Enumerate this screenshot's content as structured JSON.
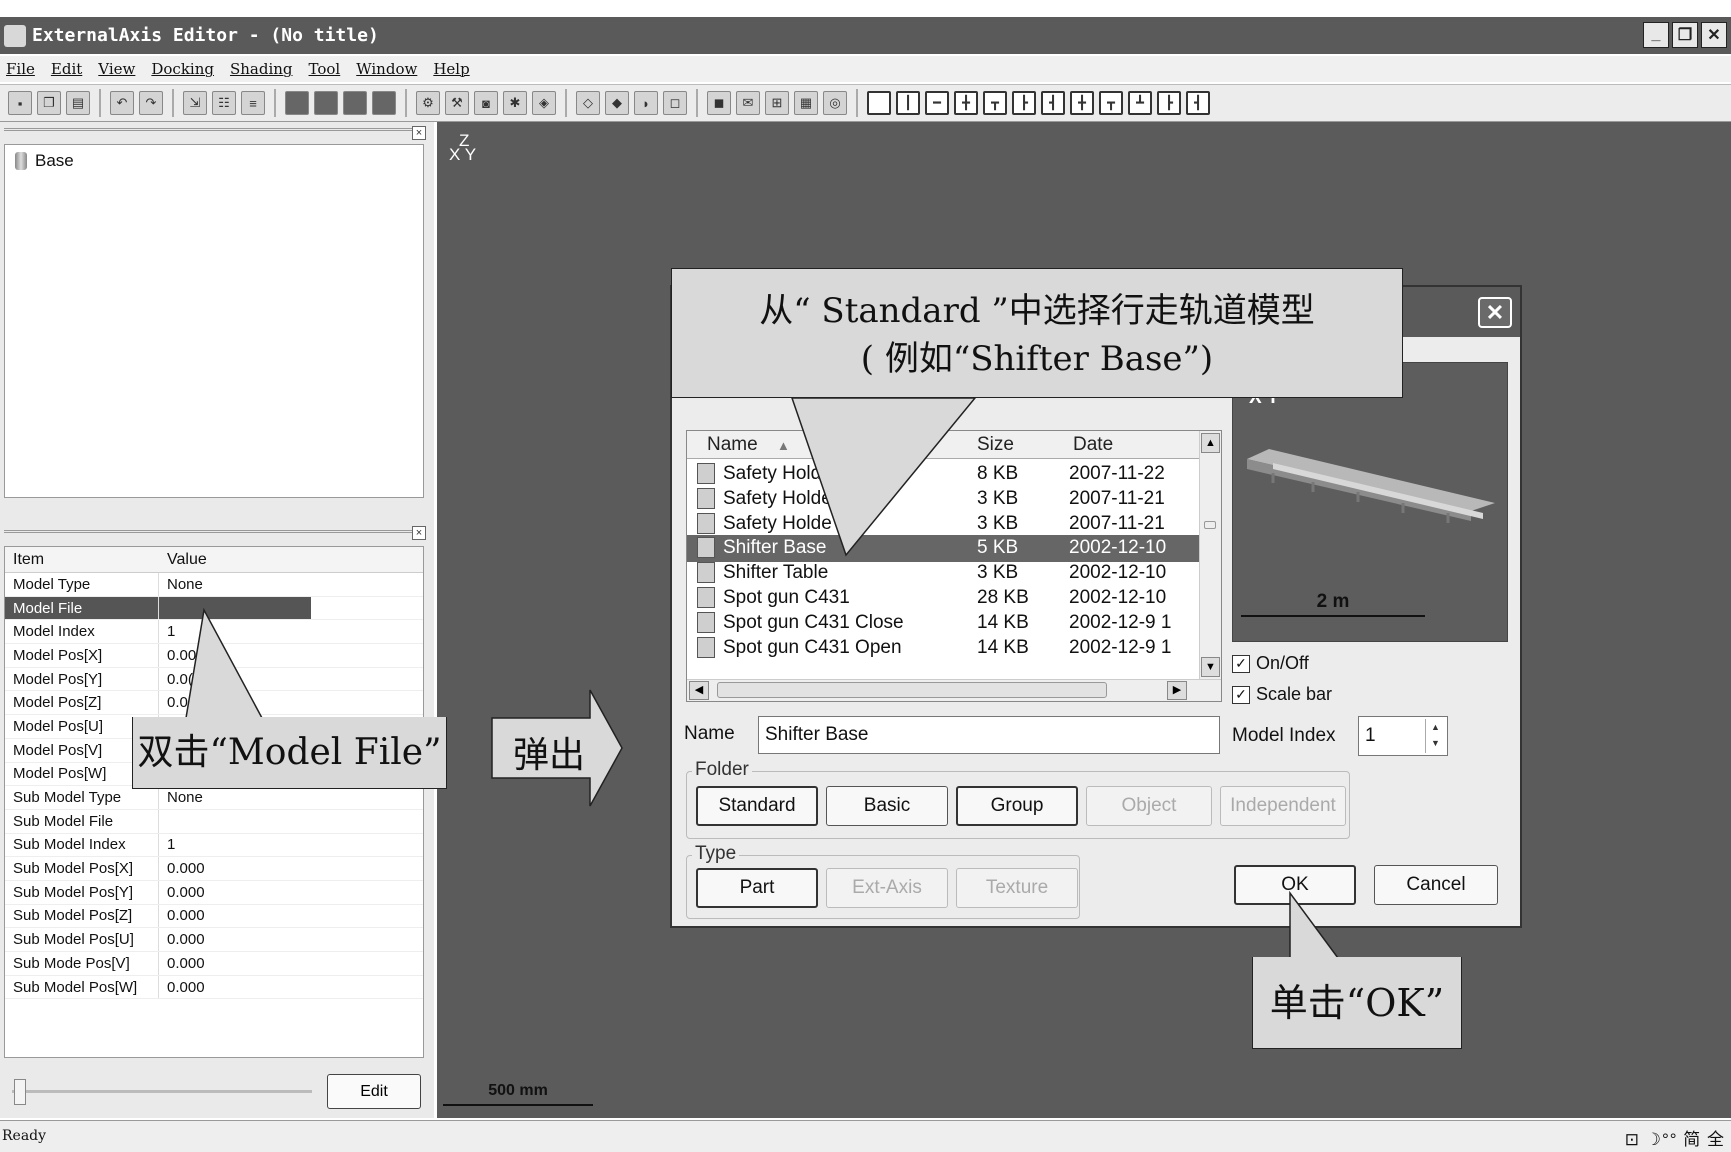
{
  "window": {
    "title": "ExternalAxis Editor - (No title)",
    "minimize": "_",
    "restore": "❐",
    "close": "✕"
  },
  "menu": [
    "File",
    "Edit",
    "View",
    "Docking",
    "Shading",
    "Tool",
    "Window",
    "Help"
  ],
  "toolbar_icons": [
    "save-icon",
    "copy-icon",
    "paste-icon",
    "undo-icon",
    "redo-icon",
    "import-icon",
    "tree-icon",
    "align-icon",
    "layer-icon",
    "robot-icon",
    "camera-icon",
    "settings-icon",
    "cube-icon",
    "view-icon",
    "layout-icon"
  ],
  "tree": {
    "root": "Base"
  },
  "properties": {
    "headers": [
      "Item",
      "Value"
    ],
    "rows": [
      {
        "item": "Model Type",
        "value": "None"
      },
      {
        "item": "Model File",
        "value": ""
      },
      {
        "item": "Model Index",
        "value": "1"
      },
      {
        "item": "Model Pos[X]",
        "value": "0.00"
      },
      {
        "item": "Model Pos[Y]",
        "value": "0.0("
      },
      {
        "item": "Model Pos[Z]",
        "value": "0.0("
      },
      {
        "item": "Model Pos[U]",
        "value": ""
      },
      {
        "item": "Model Pos[V]",
        "value": ""
      },
      {
        "item": "Model Pos[W]",
        "value": ""
      },
      {
        "item": "Sub Model Type",
        "value": "None"
      },
      {
        "item": "Sub Model File",
        "value": ""
      },
      {
        "item": "Sub Model Index",
        "value": "1"
      },
      {
        "item": "Sub Model Pos[X]",
        "value": "0.000"
      },
      {
        "item": "Sub Model Pos[Y]",
        "value": "0.000"
      },
      {
        "item": "Sub Model Pos[Z]",
        "value": "0.000"
      },
      {
        "item": "Sub Model Pos[U]",
        "value": "0.000"
      },
      {
        "item": "Sub Mode Pos[V]",
        "value": "0.000"
      },
      {
        "item": "Sub Model Pos[W]",
        "value": "0.000"
      }
    ],
    "edit_button": "Edit"
  },
  "viewport": {
    "axis_z": "Z",
    "axis_xy": "X  Y",
    "scale": "500 mm"
  },
  "status": {
    "text": "Ready",
    "ime": "⊡ ☽°° 简 全"
  },
  "dialog": {
    "close": "✕",
    "columns": [
      "Name",
      "Size",
      "Date"
    ],
    "sort_indicator": "▲",
    "files": [
      {
        "name": "Safety Hold",
        "size": "8 KB",
        "date": "2007-11-22"
      },
      {
        "name": "Safety Holde",
        "size": "3 KB",
        "date": "2007-11-21"
      },
      {
        "name": "Safety Holde",
        "size": "3 KB",
        "date": "2007-11-21"
      },
      {
        "name": "Shifter Base",
        "size": "5 KB",
        "date": "2002-12-10"
      },
      {
        "name": "Shifter Table",
        "size": "3 KB",
        "date": "2002-12-10"
      },
      {
        "name": "Spot gun C431",
        "size": "28 KB",
        "date": "2002-12-10"
      },
      {
        "name": "Spot gun C431 Close",
        "size": "14 KB",
        "date": "2002-12-9 1"
      },
      {
        "name": "Spot gun C431 Open",
        "size": "14 KB",
        "date": "2002-12-9 1"
      }
    ],
    "selected_index": 3,
    "preview": {
      "axes": "X  Y",
      "scale": "2 m"
    },
    "onoff_label": "On/Off",
    "scalebar_label": "Scale bar",
    "name_label": "Name",
    "name_value": "Shifter Base",
    "model_index_label": "Model Index",
    "model_index_value": "1",
    "folder_label": "Folder",
    "folder_buttons": [
      "Standard",
      "Basic",
      "Group",
      "Object",
      "Independent"
    ],
    "type_label": "Type",
    "type_buttons": [
      "Part",
      "Ext-Axis",
      "Texture"
    ],
    "ok": "OK",
    "cancel": "Cancel"
  },
  "callouts": {
    "standard_line1": "从“ Standard ”中选择行走轨道模型",
    "standard_line2": "( 例如“Shifter Base”)",
    "model_file": "双击“Model File”",
    "popup": "弹出",
    "ok": "单击“OK”"
  },
  "colors": {
    "titlebar": "#5a5a5a",
    "viewport": "#5b5b5b",
    "callout": "#d9d9d9",
    "selection": "#666666"
  }
}
